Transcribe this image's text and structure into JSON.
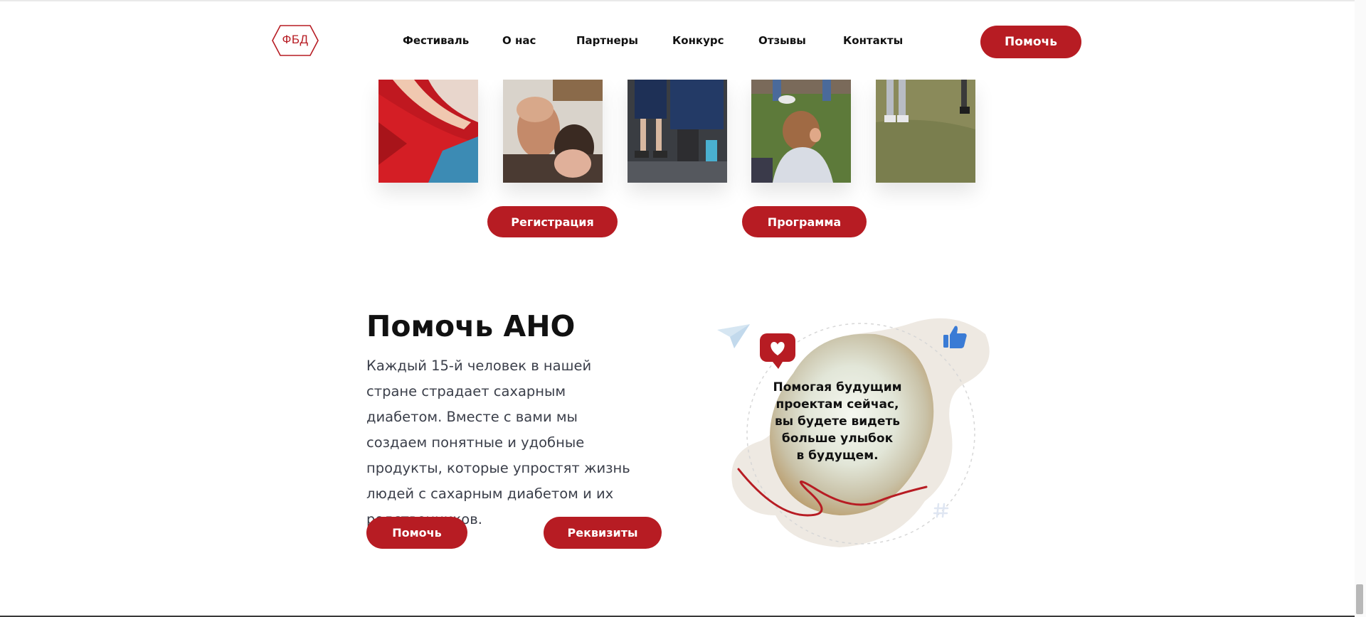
{
  "header": {
    "logo_text": "ФБД",
    "nav": [
      "Фестиваль",
      "О нас",
      "Партнеры",
      "Конкурс",
      "Отзывы",
      "Контакты"
    ],
    "help_button": "Помочь"
  },
  "festival": {
    "register_button": "Регистрация",
    "program_button": "Программа"
  },
  "help_section": {
    "title": "Помочь АНО",
    "text": "Каждый 15-й человек в нашей стране страдает сахарным диабетом. Вместе с вами мы создаем понятные и удобные продукты, которые упростят жизнь людей с сахарным диабетом и их родственников.",
    "help_button": "Помочь",
    "details_button": "Реквизиты",
    "illustration_text_lines": [
      "Помогая будущим",
      "проектам сейчас,",
      "вы будете видеть",
      "больше улыбок",
      "в будущем."
    ]
  },
  "colors": {
    "accent": "#b71c23",
    "text_dark": "#111111",
    "text_body": "#3b3f4a"
  },
  "icons": [
    "paper-plane-icon",
    "heart-icon",
    "thumbs-up-icon",
    "hashtag-icon"
  ]
}
